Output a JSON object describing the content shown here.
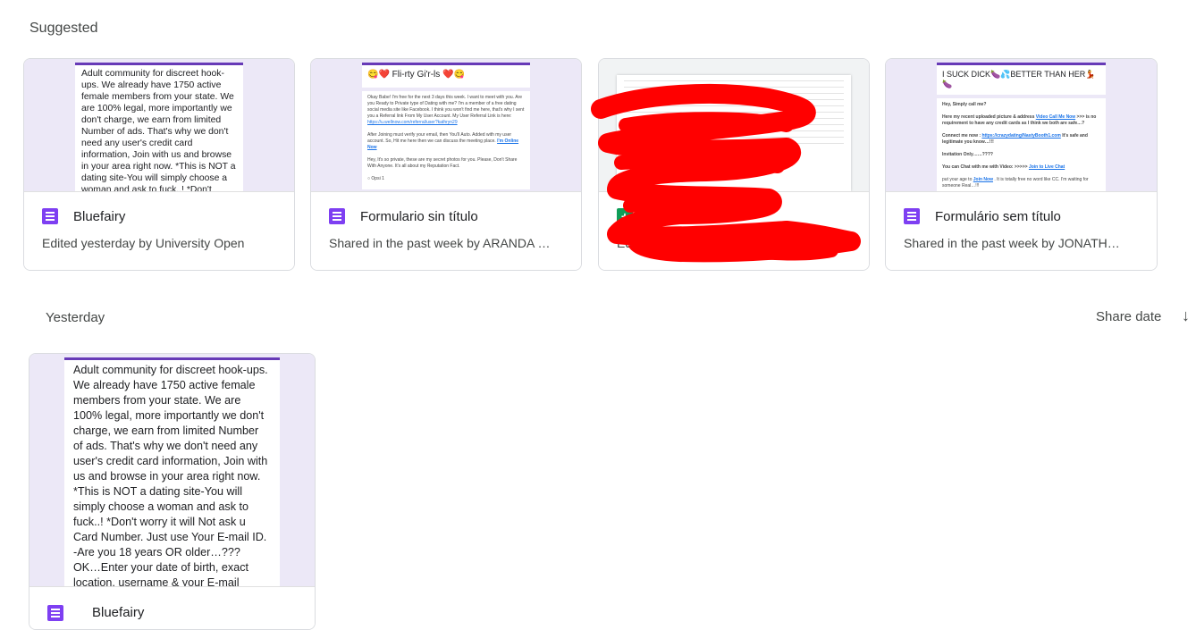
{
  "sections": {
    "suggested": "Suggested",
    "yesterday": "Yesterday"
  },
  "sort": {
    "label": "Share date",
    "arrow": "↓"
  },
  "cards": [
    {
      "name": "Bluefairy",
      "subtitle": "Edited yesterday by University Open",
      "type": "form",
      "preview": "Adult community for discreet hook-ups. We already have 1750 active female members from your state. We are 100% legal, more importantly we don't charge, we earn from limited Number of ads. That's why we don't need any user's credit card information, Join with us and browse in your area right now. *This is NOT a dating site-You will simply choose a woman and ask to fuck..! *Don't worry it will Not ask u Card Number. Just use"
    },
    {
      "name": "Formulario sin título",
      "subtitle": "Shared in the past week by ARANDA …",
      "type": "form",
      "preview_title": "😋❤️ Fli-rty Gi'r-ls ❤️😋",
      "preview": "Okay Babe! I'm free for the next 3 days this week. I want to meet with you. Are you Ready to Private type of Dating with me? I'm a member of a free dating social media site like Facebook. I think you won't find me here, that's why I sent you a Referral link From My User Account. My User Referral Link is here:",
      "preview_link": "https://u.wellnow.com/referral/user?kathryn29",
      "preview2": "After Joining must verify your email, then You'll Auto. Added with my user account. So, Hit me here then we can discuss the meeting place.",
      "preview2_link": "I'm Online Now",
      "preview3": "Hey, It's so private, these are my secret photos for you. Please, Don't Share With Anyone. It's all about my Reputation Fact.",
      "option": "Opsi 1"
    },
    {
      "name": "",
      "subtitle": "Edited in … by …",
      "type": "sheet"
    },
    {
      "name": "Formulário sem título",
      "subtitle": "Shared in the past week by JONATH…",
      "type": "form",
      "preview_title": "I SUCK DICK🍆💦BETTER THAN HER💃🍆",
      "preview": "Hey, Simply call me?",
      "preview_line2": "Here my recent uploaded picture & address",
      "preview_link": "Video Call Me Now",
      "preview_line2b": ">>> is no requirement to have any credit cards as I think we both are safe…?",
      "preview_line3": "Connect me now :",
      "preview_link2": "https://crazydating/NastyBooth1.com",
      "preview_line3b": "It's safe and legitimate you know…!!!",
      "preview_line4": "Invitation Only……????",
      "preview_line5": "You can Chat with me with Video: >>>>>",
      "preview_link3": "Join to Live Chat",
      "preview_line6": "put your age to",
      "preview_link4": "Join Now",
      "preview_line6b": ". It is totally free no word like CC. I'm waiting for someone Real…!!!"
    }
  ],
  "yesterday_card": {
    "name": "Bluefairy",
    "preview": "Adult community for discreet hook-ups. We already have 1750 active female members from your state. We are 100% legal, more importantly we don't charge, we earn from limited Number of ads. That's why we don't need any user's credit card information, Join with us and browse in your area right now. *This is NOT a dating site-You will simply choose a woman and ask to fuck..! *Don't worry it will Not ask u Card Number. Just use Your E-mail ID. -Are you 18 years OR older…??? OK…Enter your date of birth, exact location, username & your E-mail below to create you. Do you think I will"
  },
  "colors": {
    "forms_purple": "#673ab7",
    "sheets_green": "#0f9d58",
    "scribble_red": "#ff0000"
  }
}
